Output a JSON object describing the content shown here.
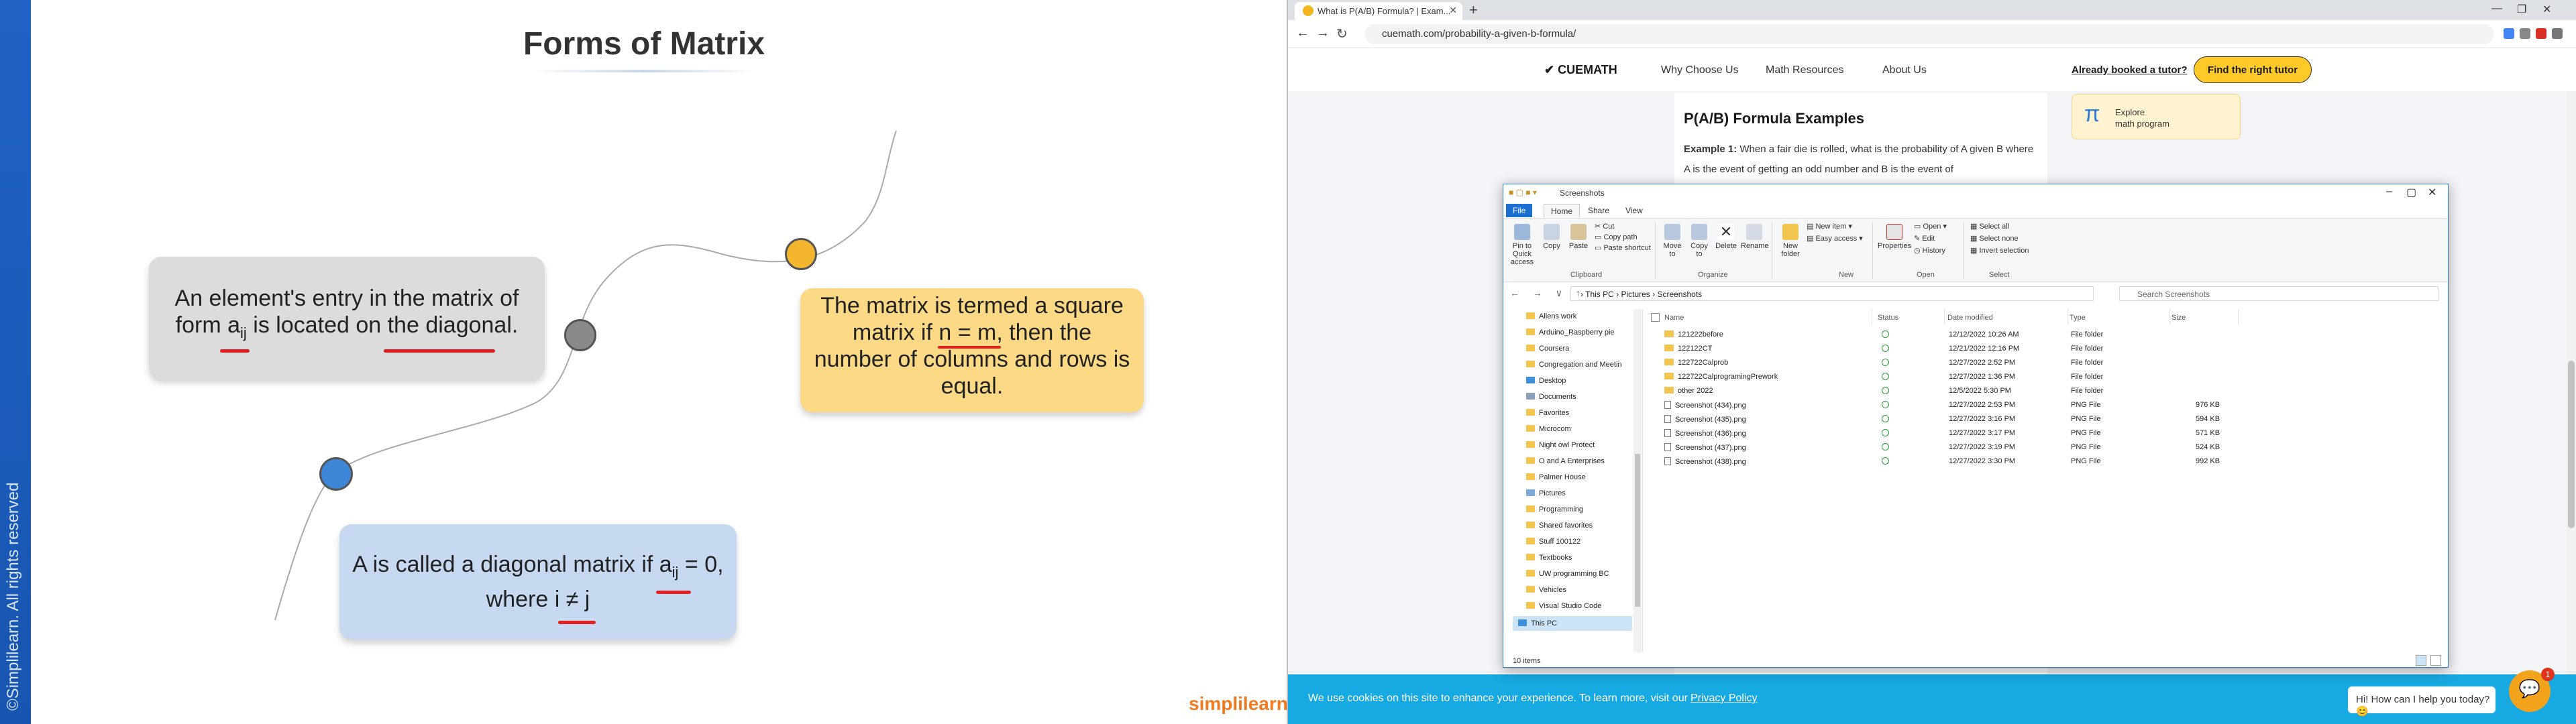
{
  "slide": {
    "title": "Forms of Matrix",
    "vertical_text": "©Simplilearn. All rights reserved",
    "logo": "simplilearn",
    "box_gray": {
      "line1": "An element's entry in the matrix of",
      "line2a": "form a",
      "sub": "ij",
      "line2b": " is located on the diagonal."
    },
    "box_yellow": {
      "line1": "The matrix is termed a square",
      "line2": "matrix if n = m, then the",
      "line3": "number of columns and rows is",
      "line4": "equal."
    },
    "box_blue": {
      "line1a": "A is called a diagonal matrix if a",
      "sub": "ij",
      "line1b": " = 0,",
      "line2": "where i ≠ j"
    }
  },
  "browser": {
    "tab_title": "What is P(A/B) Formula? | Exam...",
    "url": "cuemath.com/probability-a-given-b-formula/",
    "site": {
      "logo": "✔ CUEMATH",
      "nav": [
        "Why Choose Us",
        "Math Resources",
        "About Us"
      ],
      "booked": "Already booked a tutor?",
      "cta": "Find the right tutor",
      "article_title": "P(A/B) Formula Examples",
      "example_label": "Example 1:",
      "example_text": " When a fair die is rolled, what is the probability of A given B where A is the event of getting an odd number and B is the event of",
      "explore_line1": "Explore",
      "explore_line2": "math program"
    },
    "cookie": {
      "text": "We use cookies on this site to enhance your experience. To learn more, visit our",
      "policy": "Privacy Policy"
    },
    "help": "Hi! How can I help you today? 😊",
    "chat_badge": "1"
  },
  "explorer": {
    "title": "Screenshots",
    "tabs": [
      "File",
      "Home",
      "Share",
      "View"
    ],
    "ribbon": {
      "pin": "Pin to Quick access",
      "copy": "Copy",
      "paste": "Paste",
      "cut": "Cut",
      "copy_path": "Copy path",
      "paste_shortcut": "Paste shortcut",
      "move_to": "Move to",
      "copy_to": "Copy to",
      "delete": "Delete",
      "rename": "Rename",
      "new_folder": "New folder",
      "new_item": "New item ▾",
      "easy_access": "Easy access ▾",
      "properties": "Properties",
      "open": "Open ▾",
      "edit": "Edit",
      "history": "History",
      "select_all": "Select all",
      "select_none": "Select none",
      "invert": "Invert selection",
      "groups": [
        "Clipboard",
        "Organize",
        "New",
        "Open",
        "Select"
      ]
    },
    "path": "›  This PC  ›  Pictures  ›  Screenshots",
    "search_placeholder": "Search Screenshots",
    "sidebar": [
      "Allens work",
      "Arduino_Raspberry pie",
      "Coursera",
      "Congregation and Meetin",
      "Desktop",
      "Documents",
      "Favorites",
      "Microcom",
      "Night owl Protect",
      "O and A Enterprises",
      "Palmer House",
      "Pictures",
      "Programming",
      "Shared favorites",
      "Stuff 100122",
      "Textbooks",
      "UW programming BC",
      "Vehicles",
      "Visual Studio Code",
      "This PC"
    ],
    "columns": [
      "Name",
      "Status",
      "Date modified",
      "Type",
      "Size"
    ],
    "files": [
      {
        "name": "121222before",
        "date": "12/12/2022 10:26 AM",
        "type": "File folder",
        "size": "",
        "kind": "folder"
      },
      {
        "name": "122122CT",
        "date": "12/21/2022 12:16 PM",
        "type": "File folder",
        "size": "",
        "kind": "folder"
      },
      {
        "name": "122722Calprob",
        "date": "12/27/2022 2:52 PM",
        "type": "File folder",
        "size": "",
        "kind": "folder"
      },
      {
        "name": "122722CalprogramingPrework",
        "date": "12/27/2022 1:36 PM",
        "type": "File folder",
        "size": "",
        "kind": "folder"
      },
      {
        "name": "other 2022",
        "date": "12/5/2022 5:30 PM",
        "type": "File folder",
        "size": "",
        "kind": "folder"
      },
      {
        "name": "Screenshot (434).png",
        "date": "12/27/2022 2:53 PM",
        "type": "PNG File",
        "size": "976 KB",
        "kind": "png"
      },
      {
        "name": "Screenshot (435).png",
        "date": "12/27/2022 3:16 PM",
        "type": "PNG File",
        "size": "594 KB",
        "kind": "png"
      },
      {
        "name": "Screenshot (436).png",
        "date": "12/27/2022 3:17 PM",
        "type": "PNG File",
        "size": "571 KB",
        "kind": "png"
      },
      {
        "name": "Screenshot (437).png",
        "date": "12/27/2022 3:19 PM",
        "type": "PNG File",
        "size": "524 KB",
        "kind": "png"
      },
      {
        "name": "Screenshot (438).png",
        "date": "12/27/2022 3:30 PM",
        "type": "PNG File",
        "size": "992 KB",
        "kind": "png"
      }
    ],
    "status": "10 items"
  }
}
